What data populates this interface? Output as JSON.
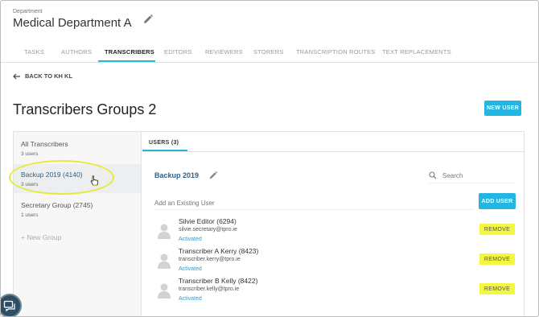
{
  "header": {
    "dept_label": "Department",
    "dept_name": "Medical Department A"
  },
  "tabs": [
    {
      "label": "TASKS",
      "active": false
    },
    {
      "label": "AUTHORS",
      "active": false
    },
    {
      "label": "TRANSCRIBERS",
      "active": true
    },
    {
      "label": "EDITORS",
      "active": false
    },
    {
      "label": "REVIEWERS",
      "active": false
    },
    {
      "label": "STORERS",
      "active": false
    },
    {
      "label": "TRANSCRIPTION ROUTES",
      "active": false
    },
    {
      "label": "TEXT REPLACEMENTS",
      "active": false
    }
  ],
  "back_link": "BACK TO KH KL",
  "page_title": "Transcribers Groups 2",
  "new_user_button": "NEW USER",
  "groups": [
    {
      "name": "All Transcribers",
      "count": "3 users",
      "selected": false
    },
    {
      "name": "Backup 2019 (4140)",
      "count": "3 users",
      "selected": true
    },
    {
      "name": "Secretary Group (2745)",
      "count": "1 users",
      "selected": false
    }
  ],
  "new_group": "+ New Group",
  "users_tab": "USERS (3)",
  "group_detail": {
    "title": "Backup 2019",
    "search_placeholder": "Search",
    "add_existing_placeholder": "Add an Existing User",
    "add_user_button": "ADD USER"
  },
  "users": [
    {
      "name": "Silvie Editor (6294)",
      "email": "silvie.secretary@tpro.ie",
      "status": "Activated",
      "action": "REMOVE"
    },
    {
      "name": "Transcriber A Kerry (8423)",
      "email": "transcriber.kerry@tpro.ie",
      "status": "Activated",
      "action": "REMOVE"
    },
    {
      "name": "Transcriber B Kelly (8422)",
      "email": "transcriber.kelly@tpro.ie",
      "status": "Activated",
      "action": "REMOVE"
    }
  ],
  "colors": {
    "accent": "#23b6e3",
    "highlight": "#f4f73f",
    "link": "#2e5f86",
    "status": "#2a9fd6"
  }
}
